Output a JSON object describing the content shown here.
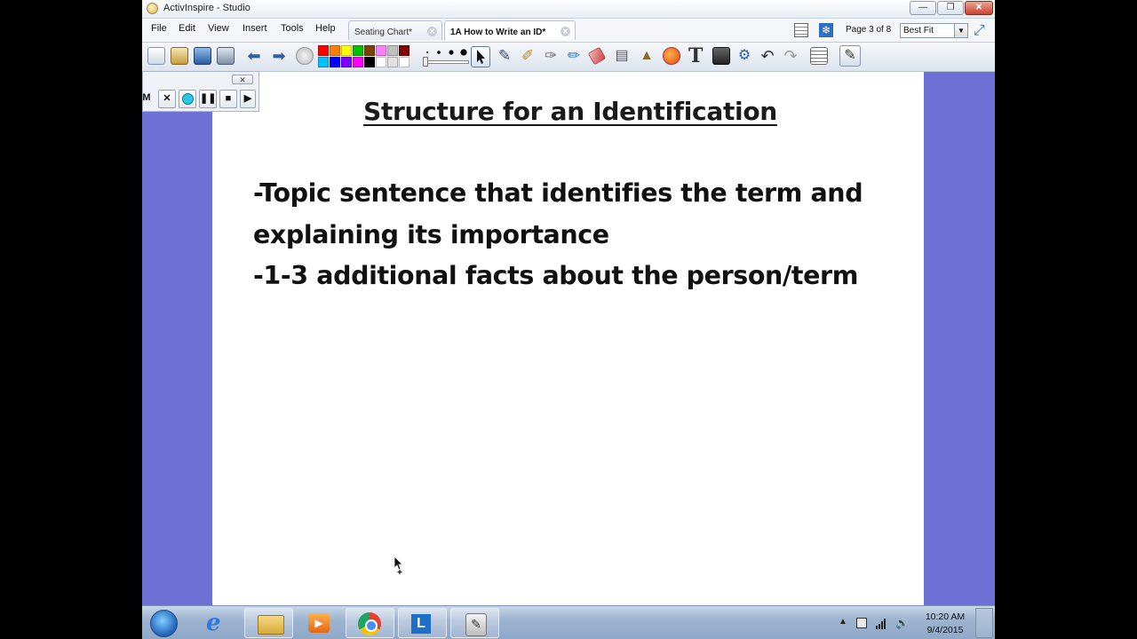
{
  "window": {
    "title": "ActivInspire - Studio"
  },
  "menu": [
    "File",
    "Edit",
    "View",
    "Insert",
    "Tools",
    "Help"
  ],
  "tabs": [
    {
      "label": "Seating Chart*",
      "active": false
    },
    {
      "label": "1A How to Write an ID*",
      "active": true
    }
  ],
  "page_indicator": "Page 3 of 8",
  "zoom": {
    "selected": "Best Fit"
  },
  "palette": [
    "#ff0000",
    "#ff8000",
    "#ffff00",
    "#00c000",
    "#804000",
    "#ff80ff",
    "#c0c0c0",
    "#800000",
    "#00c0ff",
    "#0000ff",
    "#8000ff",
    "#ff00ff",
    "#000000",
    "#ffffff",
    "#e0e0e0",
    "#ffffff"
  ],
  "recorder": {
    "label": "M"
  },
  "slide": {
    "title": "Structure for an Identification",
    "lines": [
      "-Topic sentence that identifies the term and",
      "explaining its importance",
      "-1-3 additional facts about the person/term"
    ]
  },
  "clock": {
    "time": "10:20 AM",
    "date": "9/4/2015"
  },
  "colors": {
    "canvas_bg": "#6f70d6",
    "page": "#ffffff"
  }
}
